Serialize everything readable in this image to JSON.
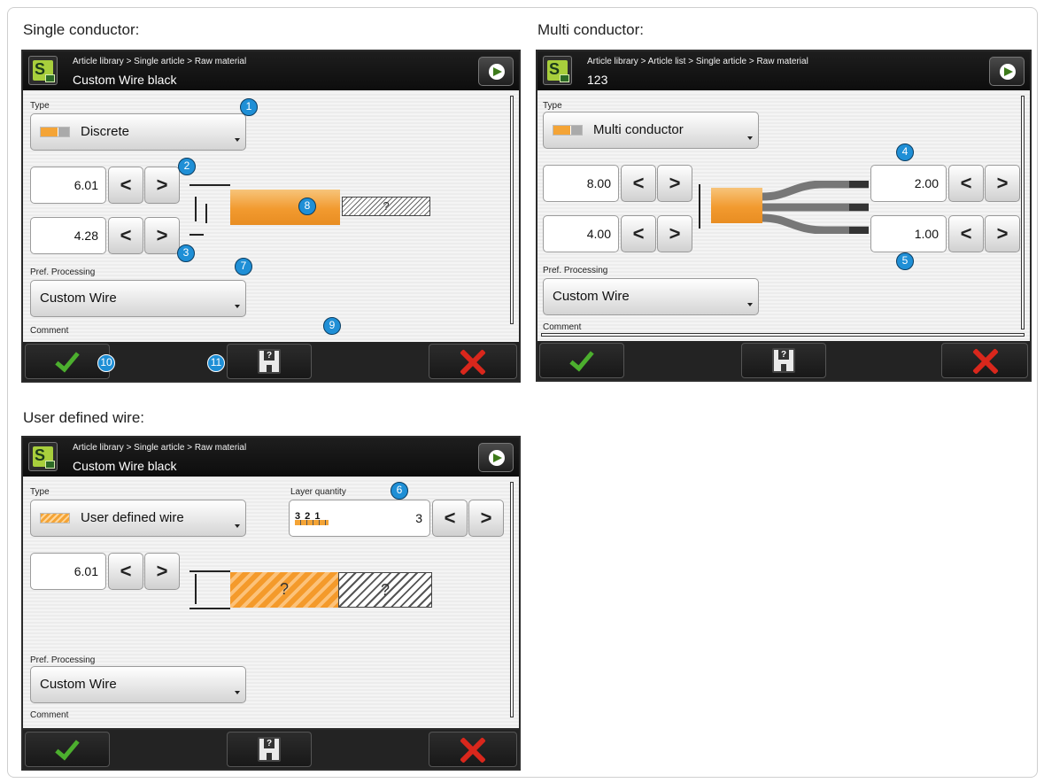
{
  "captions": {
    "single": "Single conductor:",
    "multi": "Multi conductor:",
    "user": "User defined wire:"
  },
  "screens": {
    "single": {
      "breadcrumb": "Article library > Single article > Raw material",
      "title": "Custom Wire black",
      "type_label": "Type",
      "type_value": "Discrete",
      "outer_diameter": "6.01",
      "inner_diameter": "4.28",
      "pref_label": "Pref. Processing",
      "pref_value": "Custom Wire",
      "comment_label": "Comment",
      "unknown_mark": "?"
    },
    "multi": {
      "breadcrumb": "Article library > Article list > Single article > Raw material",
      "title": "123",
      "type_label": "Type",
      "type_value": "Multi conductor",
      "outer_diameter": "8.00",
      "inner_diameter": "4.00",
      "conductor_outer": "2.00",
      "conductor_inner": "1.00",
      "pref_label": "Pref. Processing",
      "pref_value": "Custom Wire",
      "comment_label": "Comment"
    },
    "user": {
      "breadcrumb": "Article library > Single article > Raw material",
      "title": "Custom Wire black",
      "type_label": "Type",
      "type_value": "User defined wire",
      "layer_label": "Layer quantity",
      "layer_icon_text": "3 2 1",
      "layer_value": "3",
      "outer_diameter": "6.01",
      "pref_label": "Pref. Processing",
      "pref_value": "Custom Wire",
      "comment_label": "Comment",
      "unknown_mark": "?"
    }
  },
  "nav": {
    "prev": "<",
    "next": ">"
  },
  "badges": {
    "b1": "1",
    "b2": "2",
    "b3": "3",
    "b4": "4",
    "b5": "5",
    "b6": "6",
    "b7": "7",
    "b8": "8",
    "b9": "9",
    "b10": "10",
    "b11": "11"
  },
  "icons": {
    "confirm": "checkmark-icon",
    "save": "floppy-disk-icon",
    "cancel": "close-icon",
    "next": "arrow-right-icon",
    "logo": "app-logo-icon"
  },
  "colors": {
    "accent_badge": "#1f8fd6",
    "confirm": "#4caf2e",
    "cancel": "#d9271c",
    "wire": "#f29a2f",
    "logo": "#a8cf3c"
  }
}
